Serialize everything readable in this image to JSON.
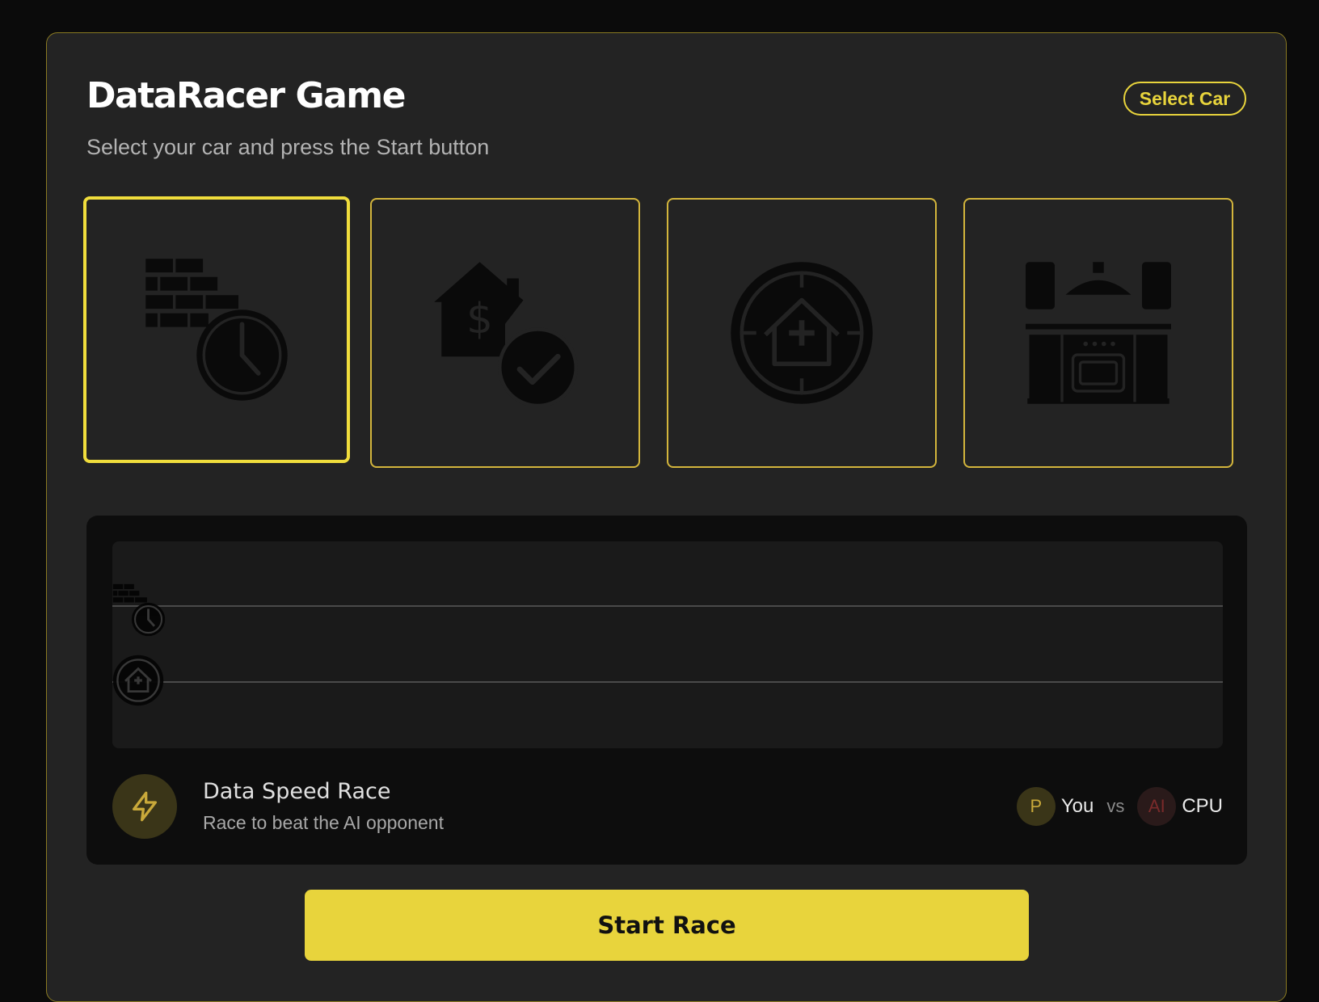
{
  "header": {
    "title": "DataRacer Game",
    "subtitle": "Select your car and press the Start button",
    "select_car_label": "Select Car"
  },
  "cars": [
    {
      "icon": "brick-wall-clock-icon",
      "selected": true
    },
    {
      "icon": "house-dollar-check-icon",
      "selected": false
    },
    {
      "icon": "house-medical-target-icon",
      "selected": false
    },
    {
      "icon": "kitchen-cabinet-icon",
      "selected": false
    }
  ],
  "race": {
    "name": "Data Speed Race",
    "description": "Race to beat the AI opponent",
    "icon": "lightning-icon",
    "player_badge": "P",
    "player_label": "You",
    "vs_label": "vs",
    "opponent_badge": "AI",
    "opponent_label": "CPU",
    "player_car_icon": "brick-wall-clock-icon",
    "opponent_car_icon": "house-medical-target-icon",
    "player_progress": 0,
    "opponent_progress": 0
  },
  "start_label": "Start Race",
  "colors": {
    "accent": "#e8d43c",
    "panel_bg": "#232323",
    "page_bg": "#0b0b0b",
    "track_bg": "#1a1a1a"
  }
}
